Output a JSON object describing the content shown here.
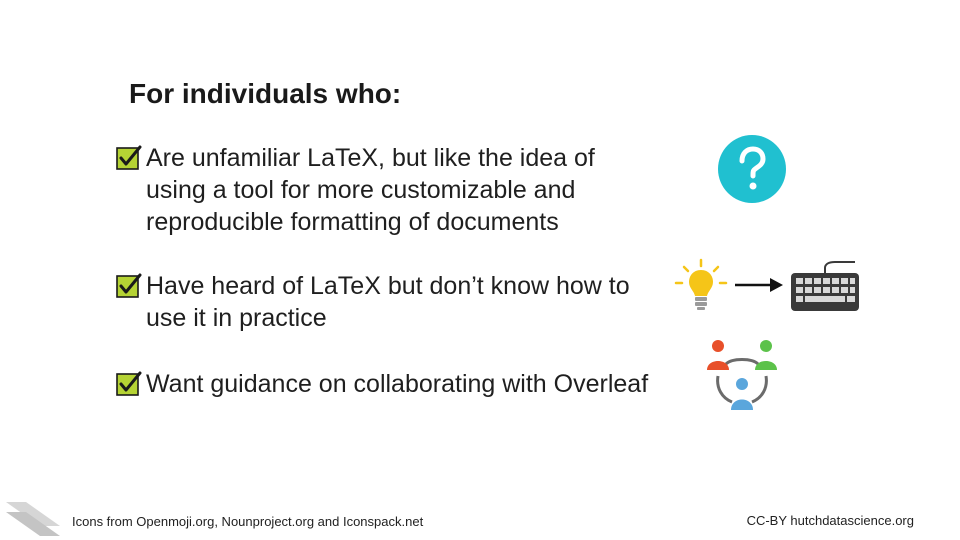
{
  "title": "For individuals who:",
  "bullets": [
    {
      "text": "  Are unfamiliar LaTeX, but like the idea of\nusing a tool for more customizable and\nreproducible formatting of documents"
    },
    {
      "text": "Have heard of LaTeX but don’t know how to\nuse it in practice"
    },
    {
      "text": "Want guidance on collaborating with Overleaf"
    }
  ],
  "icons": {
    "check": "checkbox-checked-icon",
    "question": "question-mark-icon",
    "lightbulb": "lightbulb-icon",
    "arrow": "arrow-right-icon",
    "keyboard": "keyboard-icon",
    "collaboration": "collaboration-icon"
  },
  "colors": {
    "question_circle": "#20c0d0",
    "check_fill": "#b5d334",
    "bulb": "#f5c518",
    "person_red": "#e8502a",
    "person_green": "#5cc24a",
    "person_blue": "#5aa6dc",
    "keyboard": "#3a3a3a"
  },
  "footer": {
    "attribution": "Icons from Openmoji.org, Nounproject.org and Iconspack.net",
    "license": "CC-BY hutchdatascience.org"
  }
}
